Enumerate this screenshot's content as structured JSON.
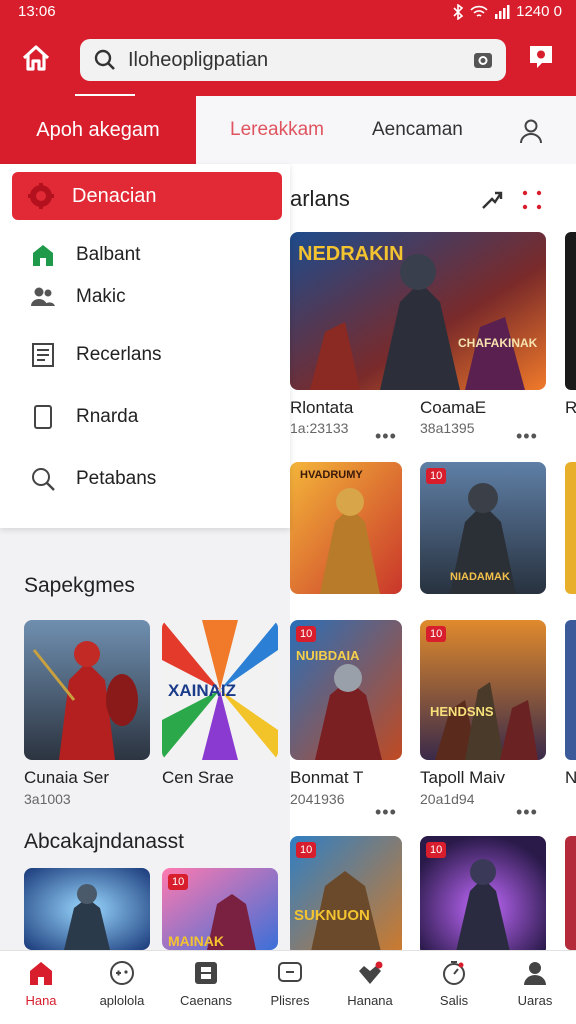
{
  "status": {
    "time": "13:06",
    "right_text": "1240 0"
  },
  "search": {
    "text": "Iloheopligpatian"
  },
  "tabs": [
    {
      "label": "Apoh akegam"
    },
    {
      "label": "Lereakkam"
    },
    {
      "label": "Aencaman"
    }
  ],
  "drawer": {
    "active_item": "Denacian",
    "items": [
      {
        "label": "Balbant",
        "icon": "home-outline-icon"
      },
      {
        "label": "Makic",
        "icon": "people-icon"
      },
      {
        "label": "Recerlans",
        "icon": "document-icon"
      },
      {
        "label": "Rnarda",
        "icon": "tablet-icon"
      },
      {
        "label": "Petabans",
        "icon": "search-icon"
      }
    ],
    "section1_title": "Sapekgmes",
    "section1_tiles": [
      {
        "label": "Cunaia Ser",
        "sub": "3a1003"
      },
      {
        "label": "Cen Srae",
        "sub": "",
        "art_text": "XAINAIZ"
      }
    ],
    "section2_title": "Abcakajndanasst",
    "section2_tiles": [
      {
        "label": "",
        "sub": ""
      },
      {
        "label": "",
        "sub": "",
        "badge": "10",
        "art_text": "MAINAK"
      }
    ]
  },
  "main": {
    "title": "arlans",
    "rows": [
      [
        {
          "label": "Rlontata",
          "sub": "1a:23133",
          "art_text": "NEDRAKIN",
          "art_text2": "CHAFAKINAK"
        },
        {
          "label": "CoamaE",
          "sub": "38a1395",
          "art_text": ""
        }
      ],
      [
        {
          "label": "",
          "sub": "",
          "art_text": "HVADRUMY"
        },
        {
          "label": "",
          "sub": "",
          "badge": "10",
          "art_text": "NIADAMAK"
        }
      ],
      [
        {
          "label": "Bonmat T",
          "sub": "2041936",
          "badge": "10",
          "art_text": "NUIBDAIA"
        },
        {
          "label": "Tapoll Maiv",
          "sub": "20a1d94",
          "badge": "10",
          "art_text": "HENDSNS"
        }
      ],
      [
        {
          "label": "",
          "sub": "",
          "badge": "10",
          "art_text": "SUKNUON"
        },
        {
          "label": "",
          "sub": "",
          "badge": "10",
          "art_text": ""
        }
      ]
    ],
    "sliver_labels": [
      "R",
      "N"
    ]
  },
  "bottom_nav": [
    {
      "label": "Hana",
      "icon": "home-icon"
    },
    {
      "label": "aplolola",
      "icon": "game-icon"
    },
    {
      "label": "Caenans",
      "icon": "gallery-icon"
    },
    {
      "label": "Plisres",
      "icon": "chat-icon"
    },
    {
      "label": "Hanana",
      "icon": "heart-icon"
    },
    {
      "label": "Salis",
      "icon": "timer-icon"
    },
    {
      "label": "Uaras",
      "icon": "profile-icon"
    }
  ],
  "colors": {
    "brand": "#d81e2c",
    "surface": "#ffffff",
    "drawer_bg": "#f2f2f4"
  }
}
